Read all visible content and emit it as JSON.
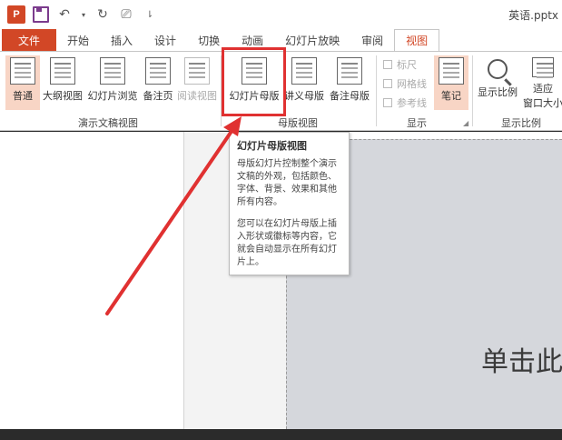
{
  "window": {
    "doc_title": "英语.pptx"
  },
  "app_badge": "P",
  "tabs": [
    {
      "label": "文件"
    },
    {
      "label": "开始"
    },
    {
      "label": "插入"
    },
    {
      "label": "设计"
    },
    {
      "label": "切换"
    },
    {
      "label": "动画"
    },
    {
      "label": "幻灯片放映"
    },
    {
      "label": "审阅"
    },
    {
      "label": "视图"
    }
  ],
  "active_tab": "视图",
  "ribbon": {
    "presentation_views": {
      "label": "演示文稿视图",
      "items": [
        {
          "label": "普通",
          "state": "selected"
        },
        {
          "label": "大纲视图"
        },
        {
          "label": "幻灯片浏览"
        },
        {
          "label": "备注页"
        },
        {
          "label": "阅读视图",
          "state": "disabled"
        }
      ]
    },
    "master_views": {
      "label": "母版视图",
      "items": [
        {
          "label": "幻灯片母版"
        },
        {
          "label": "讲义母版"
        },
        {
          "label": "备注母版"
        }
      ]
    },
    "show": {
      "label": "显示",
      "checks": [
        {
          "label": "标尺"
        },
        {
          "label": "网格线"
        },
        {
          "label": "参考线"
        }
      ],
      "notes": {
        "label": "笔记",
        "state": "selected"
      }
    },
    "zoom": {
      "label": "显示比例",
      "items": [
        {
          "label": "显示比例"
        },
        {
          "label_line1": "适应",
          "label_line2": "窗口大小"
        }
      ]
    }
  },
  "tooltip": {
    "title": "幻灯片母版视图",
    "para1": "母版幻灯片控制整个演示文稿的外观，包括颜色、字体、背景、效果和其他所有内容。",
    "para2": "您可以在幻灯片母版上插入形状或徽标等内容，它就会自动显示在所有幻灯片上。"
  },
  "slide": {
    "placeholder_text": "单击此"
  },
  "colors": {
    "accent": "#d24726",
    "highlight": "#e03131",
    "selected_bg": "#f8d5c5"
  }
}
